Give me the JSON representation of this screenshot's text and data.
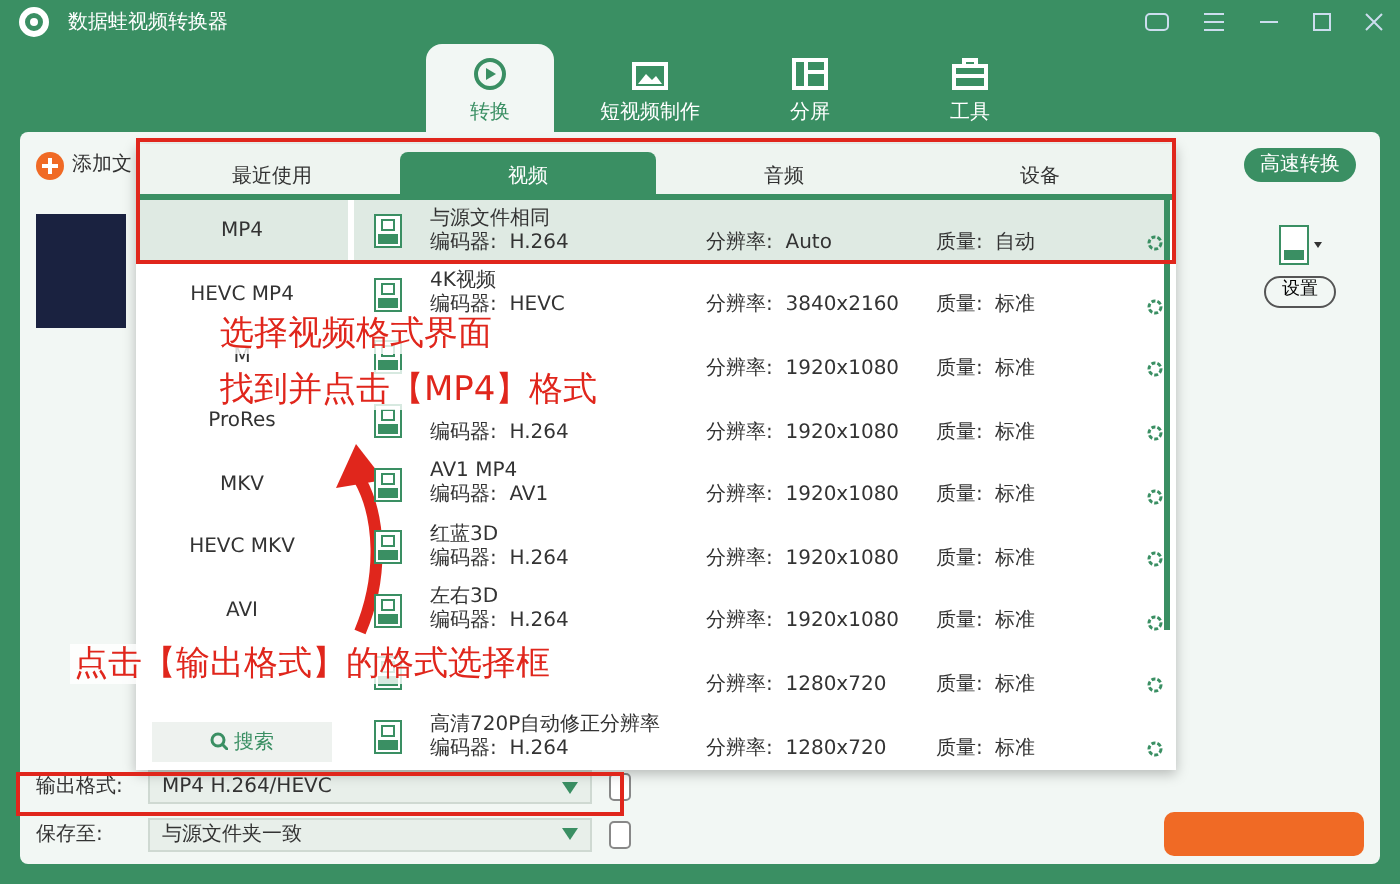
{
  "window": {
    "title": "数据蛙视频转换器"
  },
  "nav_tabs": [
    {
      "label": "转换",
      "selected": true,
      "kind": "convert"
    },
    {
      "label": "短视频制作",
      "selected": false,
      "kind": "video"
    },
    {
      "label": "分屏",
      "selected": false,
      "kind": "split"
    },
    {
      "label": "工具",
      "selected": false,
      "kind": "tools"
    }
  ],
  "main": {
    "add_file": "添加文",
    "fast_convert": "高速转换",
    "settings": "设置",
    "output_format": {
      "label": "输出格式:",
      "value": "MP4 H.264/HEVC"
    },
    "save_to": {
      "label": "保存至:",
      "value": "与源文件夹一致"
    }
  },
  "format_popup": {
    "tabs": [
      {
        "label": "最近使用",
        "selected": false
      },
      {
        "label": "视频",
        "selected": true
      },
      {
        "label": "音频",
        "selected": false
      },
      {
        "label": "设备",
        "selected": false
      }
    ],
    "formats": [
      {
        "label": "MP4",
        "selected": true
      },
      {
        "label": "HEVC MP4",
        "selected": false
      },
      {
        "label": "M",
        "selected": false
      },
      {
        "label": "ProRes",
        "selected": false
      },
      {
        "label": "MKV",
        "selected": false
      },
      {
        "label": "HEVC MKV",
        "selected": false
      },
      {
        "label": "AVI",
        "selected": false
      }
    ],
    "search": "搜索",
    "presets": [
      {
        "name": "与源文件相同",
        "encoder": {
          "label": "编码器:",
          "value": "H.264"
        },
        "resolution": {
          "label": "分辨率:",
          "value": "Auto"
        },
        "quality": {
          "label": "质量:",
          "value": "自动"
        },
        "selected": true
      },
      {
        "name": "4K视频",
        "encoder": {
          "label": "编码器:",
          "value": "HEVC"
        },
        "resolution": {
          "label": "分辨率:",
          "value": "3840x2160"
        },
        "quality": {
          "label": "质量:",
          "value": "标准"
        },
        "selected": false
      },
      {
        "resolution": {
          "label": "分辨率:",
          "value": "1920x1080"
        },
        "quality": {
          "label": "质量:",
          "value": "标准"
        },
        "selected": false
      },
      {
        "encoder": {
          "label": "编码器:",
          "value": "H.264"
        },
        "resolution": {
          "label": "分辨率:",
          "value": "1920x1080"
        },
        "quality": {
          "label": "质量:",
          "value": "标准"
        },
        "selected": false
      },
      {
        "name": "AV1 MP4",
        "encoder": {
          "label": "编码器:",
          "value": "AV1"
        },
        "resolution": {
          "label": "分辨率:",
          "value": "1920x1080"
        },
        "quality": {
          "label": "质量:",
          "value": "标准"
        },
        "selected": false
      },
      {
        "name": "红蓝3D",
        "encoder": {
          "label": "编码器:",
          "value": "H.264"
        },
        "resolution": {
          "label": "分辨率:",
          "value": "1920x1080"
        },
        "quality": {
          "label": "质量:",
          "value": "标准"
        },
        "selected": false
      },
      {
        "name": "左右3D",
        "encoder": {
          "label": "编码器:",
          "value": "H.264"
        },
        "resolution": {
          "label": "分辨率:",
          "value": "1920x1080"
        },
        "quality": {
          "label": "质量:",
          "value": "标准"
        },
        "selected": false
      },
      {
        "resolution": {
          "label": "分辨率:",
          "value": "1280x720"
        },
        "quality": {
          "label": "质量:",
          "value": "标准"
        },
        "selected": false
      },
      {
        "name": "高清720P自动修正分辨率",
        "encoder": {
          "label": "编码器:",
          "value": "H.264"
        },
        "resolution": {
          "label": "分辨率:",
          "value": "1280x720"
        },
        "quality": {
          "label": "质量:",
          "value": "标准"
        },
        "selected": false
      }
    ]
  },
  "annotations": [
    {
      "text": "选择视频格式界面"
    },
    {
      "text": "找到并点击【MP4】格式"
    },
    {
      "text": "点击【输出格式】的格式选择框"
    }
  ]
}
